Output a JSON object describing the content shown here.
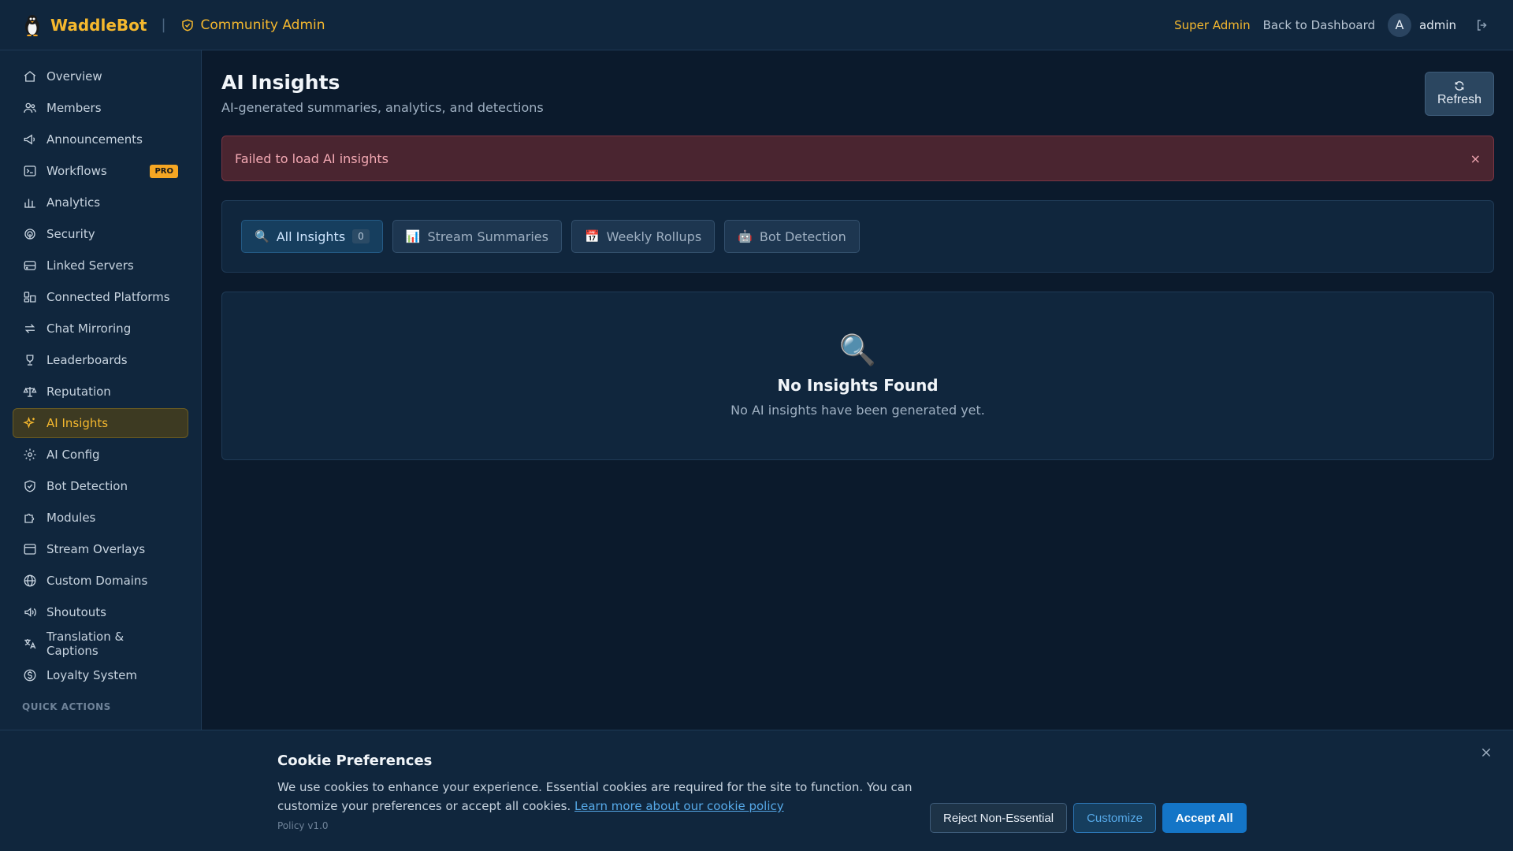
{
  "header": {
    "brand_name": "WaddleBot",
    "separator": "|",
    "community_label": "Community Admin",
    "super_admin": "Super Admin",
    "back_link": "Back to Dashboard",
    "avatar_initial": "A",
    "user_name": "admin"
  },
  "sidebar": {
    "items": [
      {
        "label": "Overview",
        "icon": "home-icon"
      },
      {
        "label": "Members",
        "icon": "users-icon"
      },
      {
        "label": "Announcements",
        "icon": "megaphone-icon"
      },
      {
        "label": "Workflows",
        "icon": "terminal-icon",
        "badge": "PRO"
      },
      {
        "label": "Analytics",
        "icon": "bar-chart-icon"
      },
      {
        "label": "Security",
        "icon": "fingerprint-icon"
      },
      {
        "label": "Linked Servers",
        "icon": "server-icon"
      },
      {
        "label": "Connected Platforms",
        "icon": "platforms-icon"
      },
      {
        "label": "Chat Mirroring",
        "icon": "arrows-icon"
      },
      {
        "label": "Leaderboards",
        "icon": "trophy-icon"
      },
      {
        "label": "Reputation",
        "icon": "scale-icon"
      },
      {
        "label": "AI Insights",
        "icon": "sparkles-icon",
        "active": true
      },
      {
        "label": "AI Config",
        "icon": "gear-icon"
      },
      {
        "label": "Bot Detection",
        "icon": "shield-check-icon"
      },
      {
        "label": "Modules",
        "icon": "puzzle-icon"
      },
      {
        "label": "Stream Overlays",
        "icon": "window-icon"
      },
      {
        "label": "Custom Domains",
        "icon": "globe-icon"
      },
      {
        "label": "Shoutouts",
        "icon": "speaker-icon"
      },
      {
        "label": "Translation & Captions",
        "icon": "translate-icon"
      },
      {
        "label": "Loyalty System",
        "icon": "dollar-icon"
      }
    ],
    "quick_actions": "QUICK ACTIONS"
  },
  "main": {
    "title": "AI Insights",
    "subtitle": "AI-generated summaries, analytics, and detections",
    "refresh_label": "Refresh",
    "alert_text": "Failed to load AI insights",
    "alert_close": "×",
    "tabs": [
      {
        "label": "All Insights",
        "icon": "🔍",
        "count": "0",
        "active": true
      },
      {
        "label": "Stream Summaries",
        "icon": "📊"
      },
      {
        "label": "Weekly Rollups",
        "icon": "📅"
      },
      {
        "label": "Bot Detection",
        "icon": "🤖"
      }
    ],
    "empty_icon": "🔍",
    "empty_title": "No Insights Found",
    "empty_text": "No AI insights have been generated yet."
  },
  "cookie": {
    "title": "Cookie Preferences",
    "text": "We use cookies to enhance your experience. Essential cookies are required for the site to function. You can customize your preferences or accept all cookies.",
    "link": "Learn more about our cookie policy",
    "policy_version": "Policy v1.0",
    "reject_label": "Reject Non-Essential",
    "customize_label": "Customize",
    "accept_label": "Accept All"
  },
  "colors": {
    "accent": "#f5b82e",
    "background": "#0b1a2c",
    "panel": "#10263d",
    "primary_button": "#1475c7",
    "error": "#f3a9b3"
  }
}
